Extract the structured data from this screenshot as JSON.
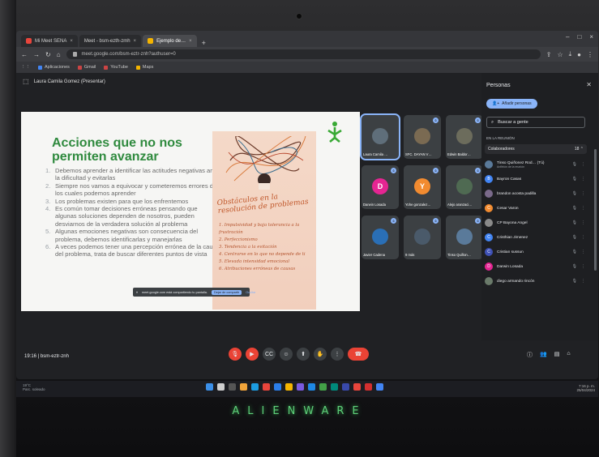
{
  "browser": {
    "tabs": [
      {
        "label": "Mi Meet  SENA"
      },
      {
        "label": "Meet - bsm-ezth-zmh"
      },
      {
        "label": "Ejemplo de…"
      }
    ],
    "new_tab": "+",
    "url": "meet.google.com/bsm-eztr-znh?authuser=0",
    "bookmarks": [
      "Aplicaciones",
      "Gmail",
      "YouTube",
      "Maps"
    ]
  },
  "meet": {
    "presenter_label": "Laura Camila Gomez (Presentar)",
    "time": "19:16",
    "meeting_code": "bsm-eztr-znh",
    "share_notice": "meet.google.com está compartiendo tu pantalla.",
    "share_stop": "Dejar de compartir",
    "share_hide": "Ocultar"
  },
  "slide": {
    "title": "Acciones que no nos permiten avanzar",
    "items": [
      "Debemos aprender a identificar las actitudes negativas ante la dificultad y evitarlas",
      "Siempre nos vamos a equivocar y cometeremos errores de los cuales podemos aprender",
      "Los problemas existen para que los enfrentemos",
      "Es común tomar decisiones erróneas pensando que algunas soluciones dependen de nosotros, pueden desviarnos de la verdadera solución al problema",
      "Algunas emociones negativas son consecuencia del problema, debemos identificarlas y manejarlas",
      "A veces podemos tener una percepción errónea de la causa del problema, trata de buscar diferentes puntos de vista"
    ],
    "image_heading": "Obstáculos en la resolución de problemas",
    "image_items": [
      "1. Impulsividad y baja tolerancia a la frustración",
      "2. Perfeccionismo",
      "3. Tendencia a la evitación",
      "4. Centrarse en lo que no depende de ti",
      "5. Elevada intensidad emocional",
      "6. Atribuciones erróneas de causas"
    ]
  },
  "tiles": [
    {
      "name": "Laura Camila …",
      "initial": "",
      "color": "#5f6e7a"
    },
    {
      "name": "SFC. DAYAN V…",
      "initial": "",
      "color": "#7a6a52"
    },
    {
      "name": "Edwin Baldor…",
      "initial": "",
      "color": "#6c6c5c"
    },
    {
      "name": "Darwin Losada",
      "initial": "D",
      "color": "#e52592"
    },
    {
      "name": "Yohe gonzalez…",
      "initial": "Y",
      "color": "#f28b30"
    },
    {
      "name": "Alejo aranzaci…",
      "initial": "",
      "color": "#4f6a52"
    },
    {
      "name": "Javier Cadena",
      "initial": "",
      "color": "#2a6fb6"
    },
    {
      "name": "9 más",
      "initial": "",
      "color": "#4a5a6a"
    },
    {
      "name": "Tinso Quiñon…",
      "initial": "",
      "color": "#5a7a9a"
    }
  ],
  "panel": {
    "title": "Personas",
    "add_people": "Añadir personas",
    "search_placeholder": "Buscar a gente",
    "section": "EN LA REUNIÓN",
    "collaborators": "Colaboradores",
    "collaborators_count": "18",
    "people": [
      {
        "name": "Tinso Quiñonez Rod… (Tú)",
        "sub": "Anfitrión de la reunión",
        "color": "#5a7a9a",
        "initial": ""
      },
      {
        "name": "Bayron Casas",
        "sub": "",
        "color": "#4285f4",
        "initial": "B"
      },
      {
        "name": "brandon acosta padilla",
        "sub": "",
        "color": "#7a6a8a",
        "initial": ""
      },
      {
        "name": "Cesar Varon",
        "sub": "",
        "color": "#f28b30",
        "initial": "C"
      },
      {
        "name": "CP Bayona Angel",
        "sub": "",
        "color": "#8a8a8a",
        "initial": ""
      },
      {
        "name": "Cristhian Jimenez",
        "sub": "",
        "color": "#4285f4",
        "initial": "C"
      },
      {
        "name": "Cristian sussun",
        "sub": "",
        "color": "#3f51b5",
        "initial": "C"
      },
      {
        "name": "Darwin Losada",
        "sub": "",
        "color": "#e52592",
        "initial": "D"
      },
      {
        "name": "diego armando rincón",
        "sub": "",
        "color": "#6a7a6a",
        "initial": ""
      }
    ]
  },
  "taskbar": {
    "weather": "19°C",
    "weather_desc": "Parc. soleado",
    "clock": "7:16 p. m.",
    "date": "25/04/2024"
  },
  "bezel_brand": "ALIENWARE"
}
